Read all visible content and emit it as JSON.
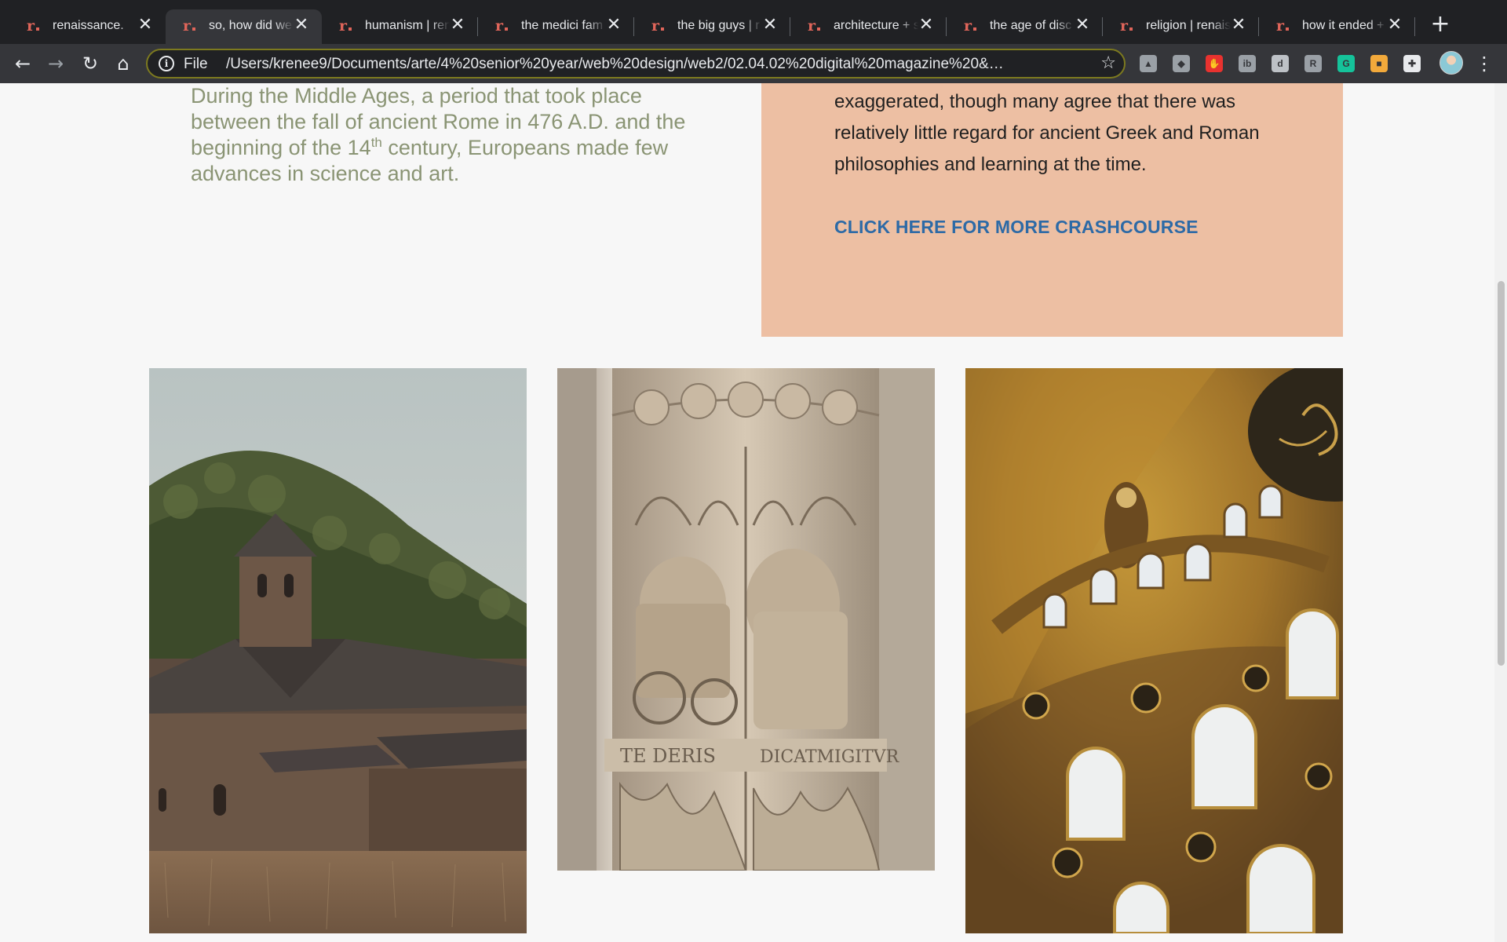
{
  "browser": {
    "tabs": [
      {
        "title": "renaissance.",
        "active": false
      },
      {
        "title": "so, how did we",
        "active": true
      },
      {
        "title": "humanism | ren",
        "active": false
      },
      {
        "title": "the medici fam",
        "active": false
      },
      {
        "title": "the big guys | r",
        "active": false
      },
      {
        "title": "architecture + s",
        "active": false
      },
      {
        "title": "the age of disc",
        "active": false
      },
      {
        "title": "religion | renais",
        "active": false
      },
      {
        "title": "how it ended +",
        "active": false
      }
    ],
    "favicon_glyph": "r.",
    "close_glyph": "✕",
    "new_tab_glyph": "+",
    "nav": {
      "back": "←",
      "forward": "→",
      "reload": "↻",
      "home": "⌂"
    },
    "address": {
      "scheme_label": "File",
      "url": "/Users/krenee9/Documents/arte/4%20senior%20year/web%20design/web2/02.04.02%20digital%20magazine%20&%20ja...",
      "info_glyph": "i",
      "star_glyph": "☆"
    },
    "extensions": [
      {
        "name": "google-drive-icon",
        "glyph": "▲",
        "color": "#9aa0a6"
      },
      {
        "name": "dropbox-icon",
        "glyph": "◆",
        "color": "#9aa0a6"
      },
      {
        "name": "adblock-icon",
        "glyph": "✋",
        "color": "#e8322f"
      },
      {
        "name": "ib-extension-icon",
        "glyph": "ib",
        "color": "#9aa0a6"
      },
      {
        "name": "d-extension-icon",
        "glyph": "d",
        "color": "#bdc1c6"
      },
      {
        "name": "r-extension-icon",
        "glyph": "R",
        "color": "#9aa0a6"
      },
      {
        "name": "grammarly-icon",
        "glyph": "G",
        "color": "#15c39a"
      },
      {
        "name": "palette-extension-icon",
        "glyph": "■",
        "color": "#f2a93b"
      },
      {
        "name": "puzzle-extensions-icon",
        "glyph": "✚",
        "color": "#e8eaed"
      }
    ],
    "menu_glyph": "⋮"
  },
  "page": {
    "intro": {
      "part1": "During the Middle Ages, a period that took place between the fall of ancient Rome in 476 A.D. and the beginning of the 14",
      "sup": "th",
      "part2": " century, Europeans made few advances in science and art."
    },
    "callout": {
      "text": "exaggerated, though many agree that there was relatively little regard for ancient Greek and Roman philosophies and learning at the time.",
      "link": "CLICK HERE FOR MORE CRASHCOURSE"
    },
    "photos": [
      {
        "name": "abbey-photo",
        "subject": "stone abbey with bell tower on wooded hillside"
      },
      {
        "name": "carved-column-photo",
        "subject": "carved gothic stone column",
        "inscription_left": "TE DERIS",
        "inscription_right": "DICATMIGITVR"
      },
      {
        "name": "dome-interior-photo",
        "subject": "golden dome interior with arched windows"
      }
    ]
  },
  "colors": {
    "intro_text": "#8a9474",
    "callout_bg": "#edbfa3",
    "link": "#2d6aa6",
    "tab_bar": "#202124",
    "toolbar": "#35363a",
    "favicon": "#e0655a"
  }
}
